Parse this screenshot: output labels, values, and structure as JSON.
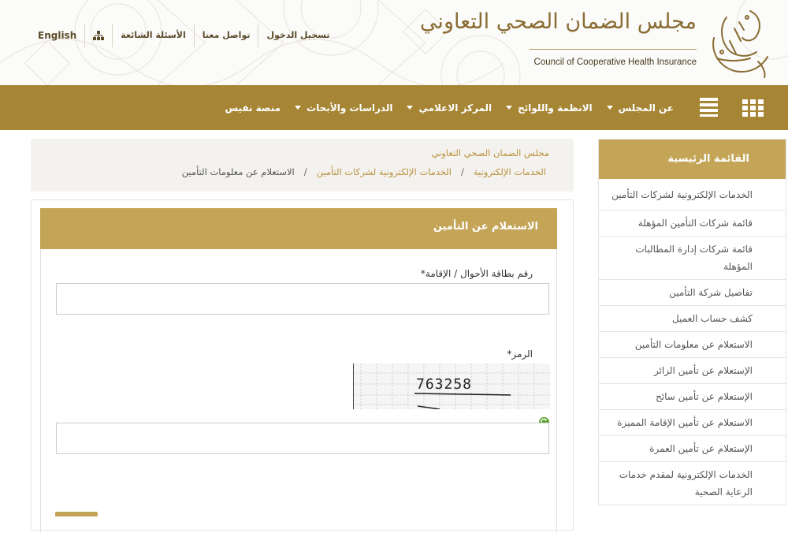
{
  "header": {
    "logo_arabic": "مجلس الضمان الصحي التعاوني",
    "logo_english": "Council of Cooperative Health Insurance",
    "top_links": {
      "login": "تسجيل الدخول",
      "contact": "تواصل معنا",
      "faq": "الأسئلة الشائعة",
      "sitemap_icon": "sitemap-icon",
      "language": "English"
    }
  },
  "nav": {
    "items": [
      {
        "label": "عن المجلس",
        "dropdown": true
      },
      {
        "label": "الانظمة واللوائح",
        "dropdown": true
      },
      {
        "label": "المركز الاعلامي",
        "dropdown": true
      },
      {
        "label": "الدراسات والأبحاث",
        "dropdown": true
      },
      {
        "label": "منصة نفيس",
        "dropdown": false
      }
    ],
    "menu_icon": "grid-menu-icon",
    "list_icon": "list-menu-icon"
  },
  "breadcrumb": {
    "site": "مجلس الضمان الصحي التعاوني",
    "path": [
      "الخدمات الإلكترونية",
      "الخدمات الإلكترونية لشركات التأمين",
      "الاستعلام عن معلومات التأمين"
    ],
    "separator": "/"
  },
  "form": {
    "title": "الاستعلام عن التأمين",
    "id_label": "رقم بطاقة الأحوال / الإقامة*",
    "id_value": "",
    "code_label": "الرمز*",
    "code_value": "",
    "captcha_text": "763258"
  },
  "sidebar": {
    "title": "القائمة الرئيسية",
    "items": [
      "الخدمات الإلكترونية لشركات التأمين",
      "قائمة شركات التأمين المؤهلة",
      "قائمة شركات إدارة المطالبات المؤهلة",
      "تفاصيل شركة التأمين",
      "كشف حساب العميل",
      "الاستعلام عن معلومات التأمين",
      "الإستعلام عن تأمين الزائر",
      "الإستعلام عن تأمين سائح",
      "الاستعلام عن تأمين الإقامة المميزة",
      "الإستعلام عن تأمين العمرة",
      "الخدمات الإلكترونية لمقدم خدمات الرعاية الصحية"
    ]
  },
  "colors": {
    "nav_bg": "#a68635",
    "panel_header": "#c4a457",
    "link_gold": "#b9913e",
    "breadcrumb_bg": "#f4f2ee"
  }
}
